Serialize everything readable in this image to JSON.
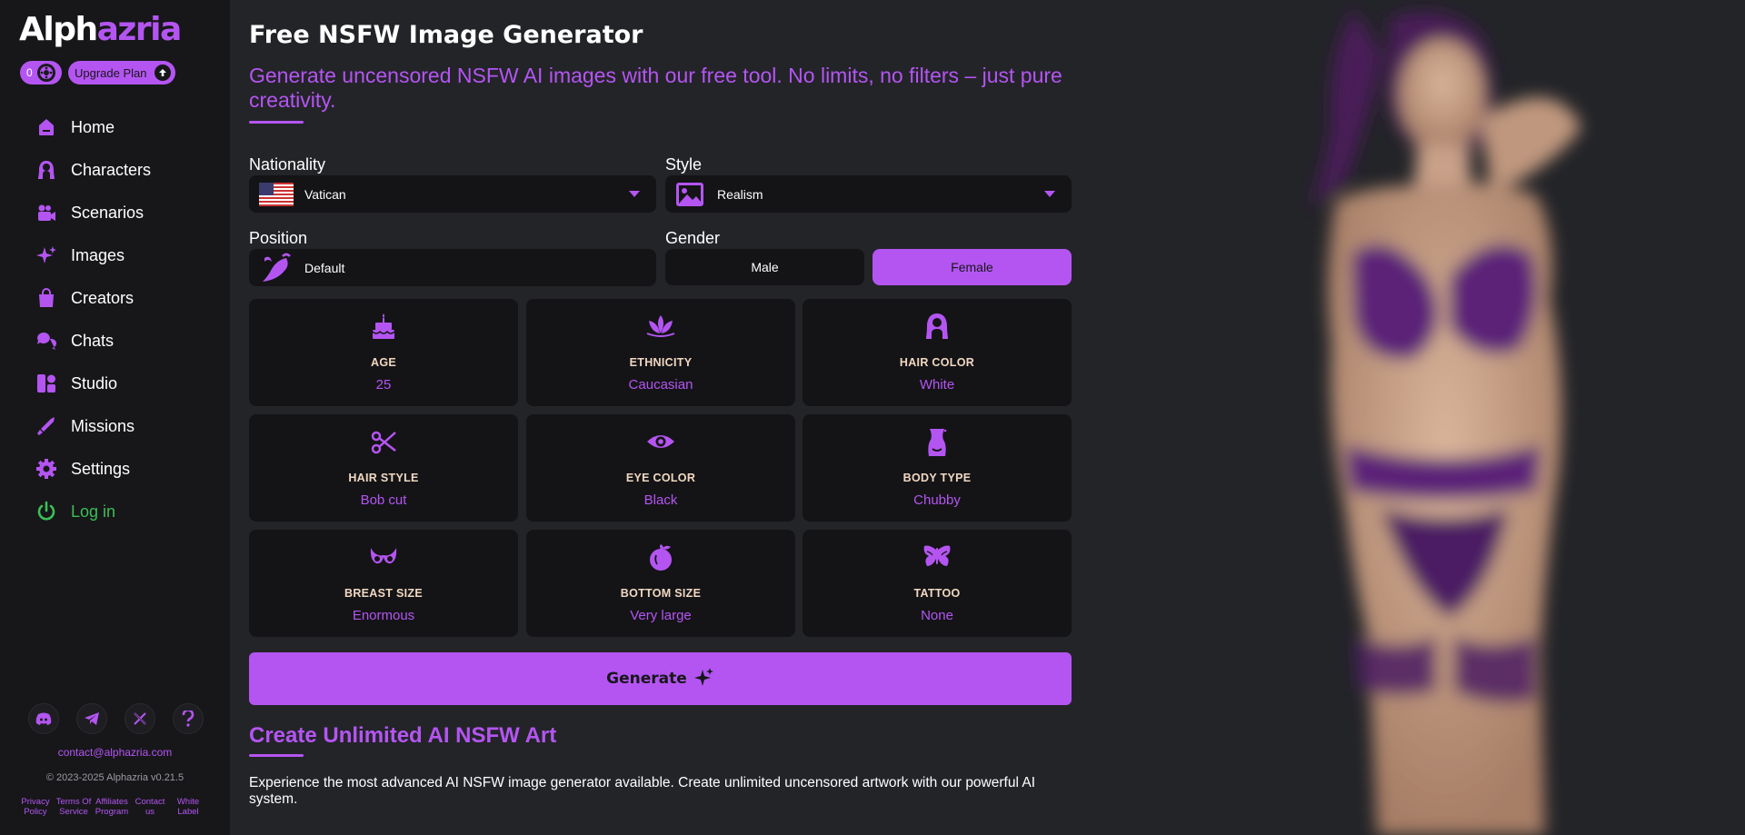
{
  "brand": {
    "part1": "Alph",
    "part2": "azria",
    "accent": "#b455f2"
  },
  "account": {
    "credits": "0",
    "upgrade_label": "Upgrade Plan"
  },
  "nav": [
    {
      "label": "Home",
      "icon": "home-icon"
    },
    {
      "label": "Characters",
      "icon": "characters-icon"
    },
    {
      "label": "Scenarios",
      "icon": "scenarios-icon"
    },
    {
      "label": "Images",
      "icon": "images-icon"
    },
    {
      "label": "Creators",
      "icon": "creators-icon"
    },
    {
      "label": "Chats",
      "icon": "chats-icon"
    },
    {
      "label": "Studio",
      "icon": "studio-icon"
    },
    {
      "label": "Missions",
      "icon": "missions-icon"
    },
    {
      "label": "Settings",
      "icon": "settings-icon"
    },
    {
      "label": "Log in",
      "icon": "power-icon"
    }
  ],
  "socials": [
    "discord-icon",
    "telegram-icon",
    "x-icon",
    "help-icon"
  ],
  "footer": {
    "contact": "contact@alphazria.com",
    "copyright": "© 2023-2025 Alphazria v0.21.5",
    "links": [
      {
        "l1": "Privacy",
        "l2": "Policy"
      },
      {
        "l1": "Terms Of",
        "l2": "Service"
      },
      {
        "l1": "Affiliates",
        "l2": "Program"
      },
      {
        "l1": "Contact",
        "l2": "us"
      },
      {
        "l1": "White",
        "l2": "Label"
      }
    ]
  },
  "main": {
    "title": "Free NSFW Image Generator",
    "subtitle": "Generate uncensored NSFW AI images with our free tool. No limits, no filters – just pure creativity.",
    "nationality": {
      "label": "Nationality",
      "value": "Vatican"
    },
    "style": {
      "label": "Style",
      "value": "Realism"
    },
    "position": {
      "label": "Position",
      "value": "Default"
    },
    "gender": {
      "label": "Gender",
      "options": [
        "Male",
        "Female"
      ],
      "selected": "Female"
    },
    "attributes": [
      {
        "title": "AGE",
        "value": "25",
        "icon": "cake-icon"
      },
      {
        "title": "ETHNICITY",
        "value": "Caucasian",
        "icon": "lotus-icon"
      },
      {
        "title": "HAIR COLOR",
        "value": "White",
        "icon": "hair-icon"
      },
      {
        "title": "HAIR STYLE",
        "value": "Bob cut",
        "icon": "scissors-icon"
      },
      {
        "title": "EYE COLOR",
        "value": "Black",
        "icon": "eye-icon"
      },
      {
        "title": "BODY TYPE",
        "value": "Chubby",
        "icon": "body-icon"
      },
      {
        "title": "BREAST SIZE",
        "value": "Enormous",
        "icon": "bra-icon"
      },
      {
        "title": "BOTTOM SIZE",
        "value": "Very large",
        "icon": "peach-icon"
      },
      {
        "title": "TATTOO",
        "value": "None",
        "icon": "butterfly-icon"
      }
    ],
    "generate_label": "Generate",
    "section_title": "Create Unlimited AI NSFW Art",
    "section_text": "Experience the most advanced AI NSFW image generator available. Create unlimited uncensored artwork with our powerful AI system."
  }
}
